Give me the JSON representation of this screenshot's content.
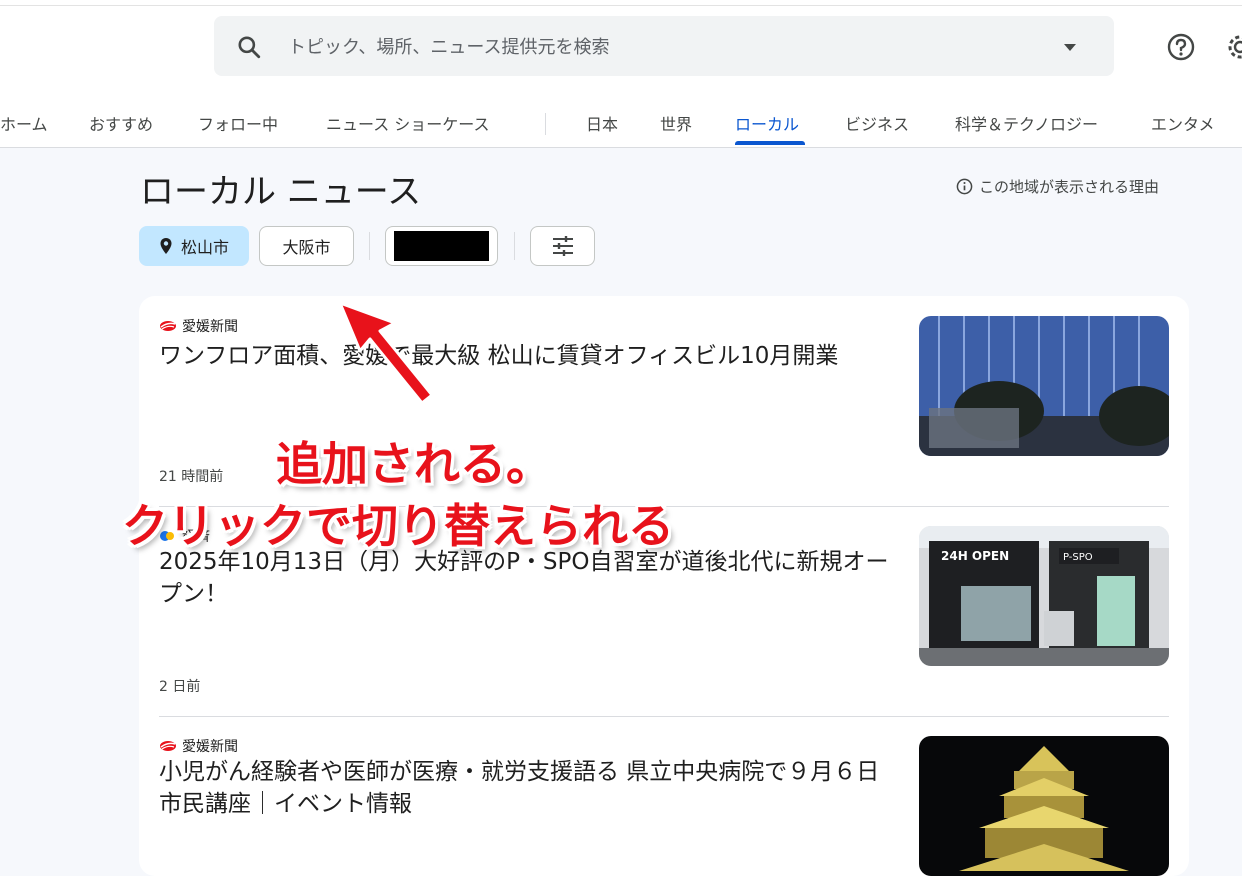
{
  "header": {
    "search_placeholder": "トピック、場所、ニュース提供元を検索",
    "icons": [
      "search-icon",
      "dropdown-caret-icon",
      "help-icon",
      "settings-gear-icon"
    ]
  },
  "tabs": [
    {
      "label": "ホーム"
    },
    {
      "label": "おすすめ"
    },
    {
      "label": "フォロー中"
    },
    {
      "label": "ニュース ショーケース"
    },
    {
      "label": "日本"
    },
    {
      "label": "世界"
    },
    {
      "label": "ローカル",
      "active": true
    },
    {
      "label": "ビジネス"
    },
    {
      "label": "科学＆テクノロジー"
    },
    {
      "label": "エンタメ"
    }
  ],
  "page": {
    "title": "ローカル ニュース",
    "why_label": "この地域が表示される理由"
  },
  "chips": [
    {
      "label": "松山市",
      "selected": true,
      "icon": "location-pin-icon"
    },
    {
      "label": "大阪市",
      "selected": false
    },
    {
      "label": "",
      "redacted": true
    },
    {
      "icon": "tune-filter-icon"
    }
  ],
  "articles": [
    {
      "source": "愛媛新聞",
      "headline": "ワンフロア面積、愛媛で最大級 松山に賃貸オフィスビル10月開業",
      "time": "21 時間前"
    },
    {
      "source": "経済",
      "headline": "2025年10月13日（月）大好評のP・SPO自習室が道後北代に新規オープン！",
      "time": "2 日前"
    },
    {
      "source": "愛媛新聞",
      "headline": "小児がん経験者や医師が医療・就労支援語る 県立中央病院で９月６日市民講座｜イベント情報",
      "time": ""
    }
  ],
  "annotation": {
    "line1": "追加される。",
    "line2": "クリックで切り替えられる",
    "color": "#e8121b"
  },
  "colors": {
    "accent": "#0b57d0",
    "chip_selected": "#c2e7ff",
    "background": "#f6f8fc"
  }
}
